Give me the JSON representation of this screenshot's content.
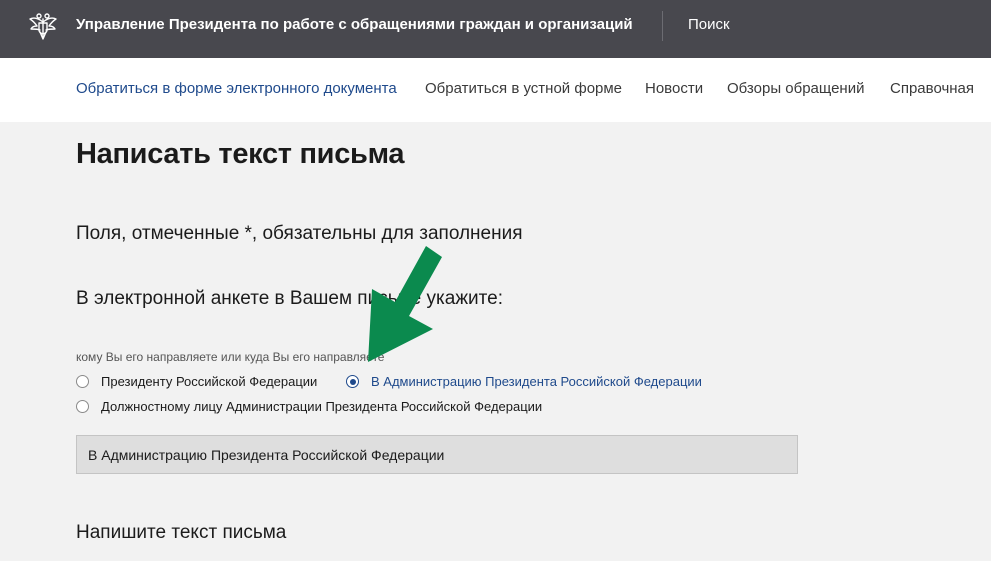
{
  "header": {
    "site_title": "Управление Президента по работе с обращениями граждан и организаций",
    "search_label": "Поиск",
    "emblem_icon": "double-headed-eagle-icon",
    "background": "#48484e"
  },
  "nav": {
    "items": [
      {
        "label": "Обратиться в форме электронного документа",
        "active": true
      },
      {
        "label": "Обратиться в устной форме",
        "active": false
      },
      {
        "label": "Новости",
        "active": false
      },
      {
        "label": "Обзоры обращений",
        "active": false
      },
      {
        "label": "Справочная",
        "active": false
      }
    ],
    "active_color": "#1f4a8c"
  },
  "form": {
    "title": "Написать текст письма",
    "required_note": "Поля, отмеченные *, обязательны для заполнения",
    "instruction": "В электронной анкете в Вашем письме укажите:",
    "recipient_label": "кому Вы его направляете или куда Вы его направляете",
    "recipient_options": [
      {
        "label": "Президенту Российской Федерации",
        "checked": false
      },
      {
        "label": "В Администрацию Президента Российской Федерации",
        "checked": true
      },
      {
        "label": "Должностному лицу Администрации Президента Российской Федерации",
        "checked": false
      }
    ],
    "selected_value": "В Администрацию Президента Российской Федерации",
    "letter_heading": "Напишите текст письма"
  },
  "annotation": {
    "arrow_icon": "green-pointer-arrow-icon",
    "color": "#0b8a4e"
  }
}
